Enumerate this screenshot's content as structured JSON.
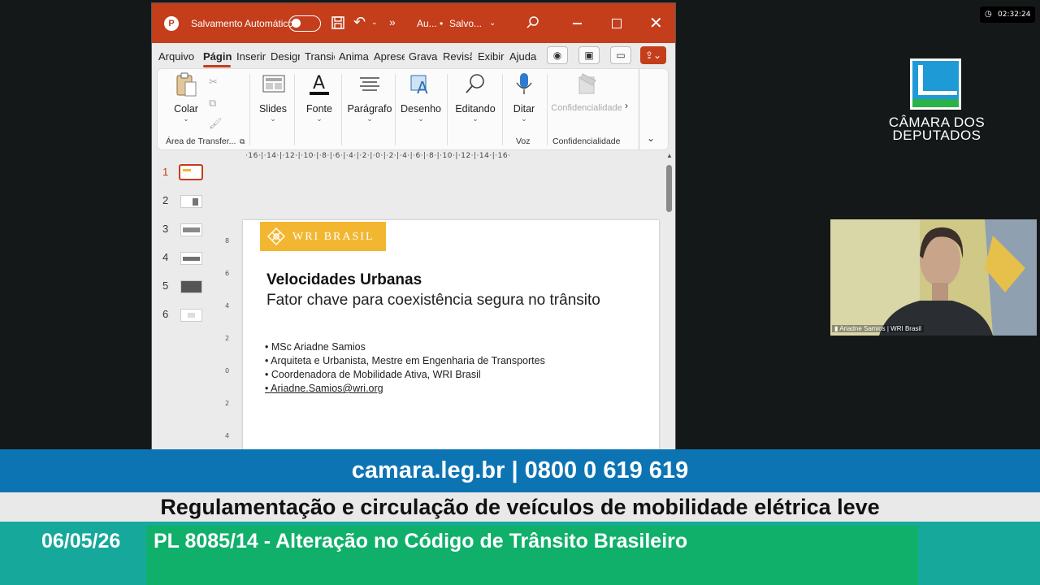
{
  "ppt": {
    "autosave_label": "Salvamento Automático",
    "autosave_state": "off",
    "doc_name": "Au...",
    "saved_status": "Salvo...",
    "tabs": [
      "Arquivo",
      "Página",
      "Inserir",
      "Design",
      "Transiç",
      "Anima",
      "Apresenta",
      "Gravar",
      "Revisão",
      "Exibir",
      "Ajuda"
    ],
    "active_tab": "Página",
    "ribbon": {
      "colar": "Colar",
      "area_transfer": "Área de Transfer...",
      "slides": "Slides",
      "fonte": "Fonte",
      "paragrafo": "Parágrafo",
      "desenho": "Desenho",
      "editando": "Editando",
      "ditar": "Ditar",
      "voz": "Voz",
      "confidencialidade": "Confidencialidade",
      "confidencialidade_group": "Confidencialidade"
    },
    "ruler_h": "·16·|·14·|·12·|·10·|·8·|·6·|·4·|·2·|·0·|·2·|·4·|·6·|·8·|·10·|·12·|·14·|·16·",
    "ruler_v": [
      "8",
      "6",
      "4",
      "2",
      "0",
      "2",
      "4"
    ],
    "slide_numbers": [
      "1",
      "2",
      "3",
      "4",
      "5",
      "6"
    ],
    "selected_slide": "1",
    "slide": {
      "logo_text": "WRI BRASIL",
      "title": "Velocidades Urbanas",
      "subtitle": "Fator chave para coexistência segura no trânsito",
      "bullets": [
        "MSc Ariadne Samios",
        "Arquiteta e Urbanista, Mestre em Engenharia de Transportes",
        "Coordenadora de Mobilidade Ativa, WRI Brasil",
        "Ariadne.Samios@wri.org"
      ]
    }
  },
  "clock": "02:32:24",
  "camara": {
    "name_line1": "CÂMARA DOS",
    "name_line2": "DEPUTADOS"
  },
  "video": {
    "caption": "Ariadne Samios | WRI Brasil"
  },
  "lower_third": {
    "contact": "camara.leg.br | 0800 0 619 619",
    "topic": "Regulamentação e circulação de veículos de mobilidade elétrica leve",
    "date": "06/05/26",
    "bill": "PL 8085/14 - Alteração no Código de Trânsito Brasileiro"
  },
  "colors": {
    "ppt_accent": "#c43e1c",
    "wri_yellow": "#f3b631",
    "blue_bar": "#0d74b3",
    "green_bar": "#10b06a",
    "teal_bar": "#16a89b"
  }
}
